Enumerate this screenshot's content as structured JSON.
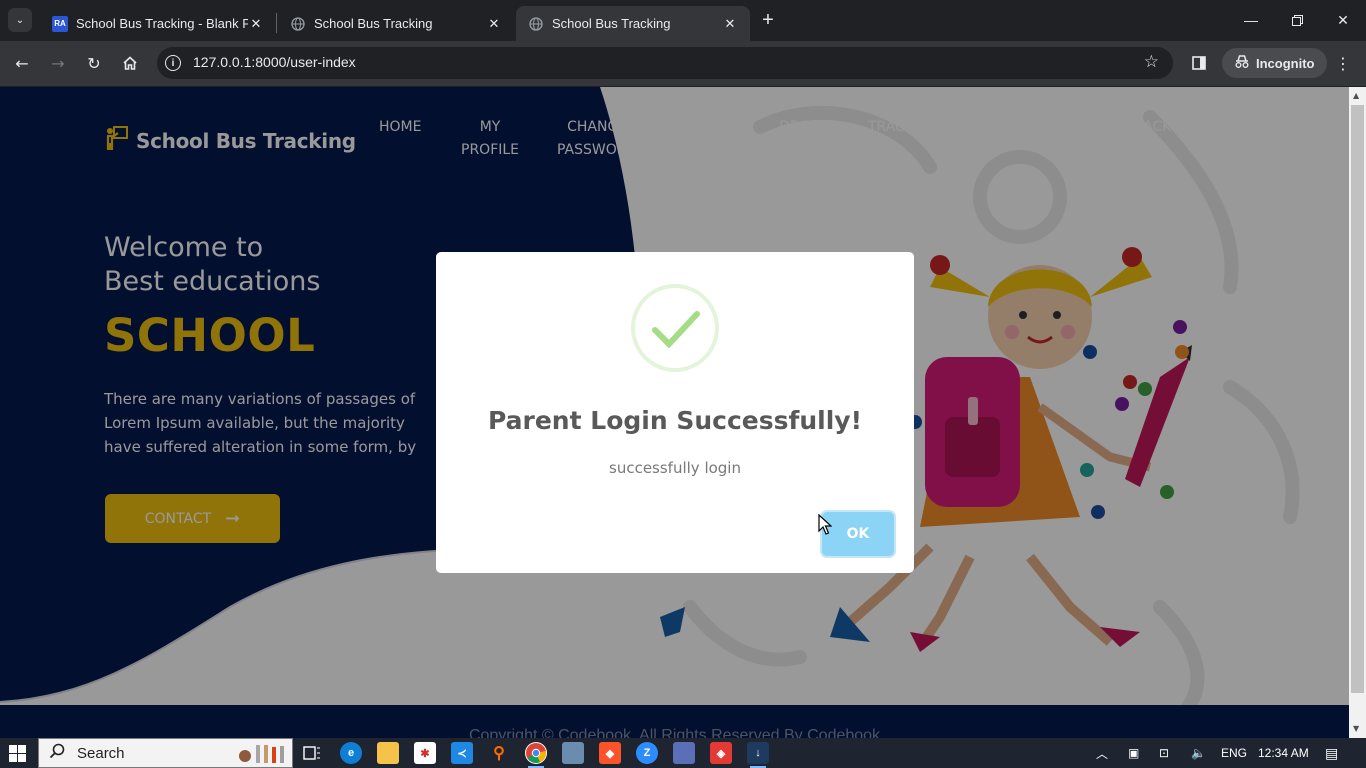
{
  "browser": {
    "tabs": [
      {
        "title": "School Bus Tracking - Blank Pa",
        "favicon": "RA",
        "active": false
      },
      {
        "title": "School Bus Tracking",
        "favicon": "globe-icon",
        "active": false
      },
      {
        "title": "School Bus Tracking",
        "favicon": "globe-icon",
        "active": true
      }
    ],
    "url": "127.0.0.1:8000/user-index",
    "incognito_label": "Incognito"
  },
  "site": {
    "brand": "School Bus Tracking",
    "nav": [
      {
        "label": "HOME"
      },
      {
        "label": "MY\nPROFILE"
      },
      {
        "label": "CHANGE\nPASSWORD"
      },
      {
        "label": "BOARD\nSTATUS"
      },
      {
        "label": "DROP\nSTATUS"
      },
      {
        "label": "TRACK"
      },
      {
        "label": "NOTIFICATION"
      },
      {
        "label": "FEEDBACK"
      },
      {
        "label": "LOGOUT"
      }
    ],
    "hero": {
      "welcome": "Welcome to\nBest educations",
      "headline": "SCHOOL",
      "description": "There are many variations of passages of Lorem Ipsum available, but the majority have suffered alteration in some form, by injected humour, or randomised words",
      "contact_label": "CONTACT",
      "contact_arrow": "➞"
    },
    "footer": "Copyright © Codebook. All Rights Reserved By Codebook"
  },
  "modal": {
    "title": "Parent Login Successfully!",
    "text": "successfully login",
    "ok_label": "OK"
  },
  "taskbar": {
    "search_label": "Search",
    "language": "ENG",
    "time": "12:34 AM"
  },
  "colors": {
    "navy": "#051a4d",
    "accent_yellow": "#f2c20f",
    "ok_button": "#8cd4f5",
    "success_green": "#a5dc86"
  }
}
